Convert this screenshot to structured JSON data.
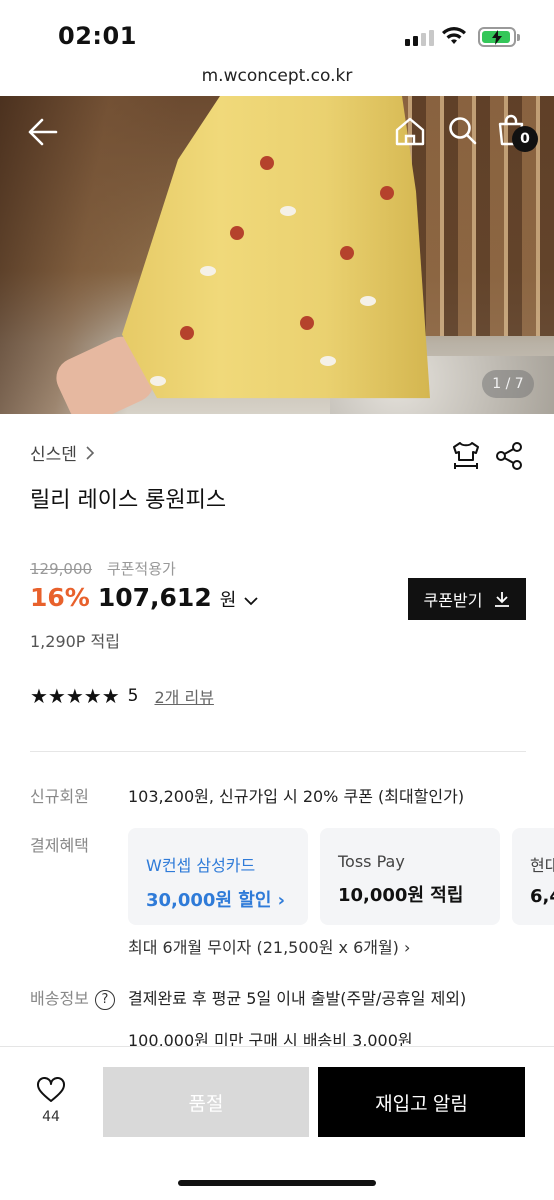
{
  "status_bar": {
    "time": "02:01"
  },
  "browser": {
    "url": "m.wconcept.co.kr"
  },
  "hero": {
    "counter": "1 / 7",
    "cart_count": "0"
  },
  "product": {
    "brand": "신스덴",
    "name": "릴리 레이스 롱원피스",
    "original_price": "129,000",
    "coupon_price_label": "쿠폰적용가",
    "discount": "16%",
    "price": "107,612",
    "currency": "원",
    "points": "1,290P 적립",
    "rating_stars": 5,
    "rating_score": "5",
    "reviews": "2개 리뷰"
  },
  "coupon_button": {
    "label": "쿠폰받기"
  },
  "info": {
    "new_member_label": "신규회원",
    "new_member_value": "103,200원, 신규가입 시 20% 쿠폰 (최대할인가)",
    "payment_label": "결제혜택",
    "payment_cards": [
      {
        "title": "W컨셉 삼성카드",
        "benefit": "30,000원 할인 ›"
      },
      {
        "title": "Toss Pay",
        "benefit": "10,000원 적립"
      },
      {
        "title": "현대",
        "benefit": "6,4"
      }
    ],
    "installment": "최대 6개월 무이자 (21,500원 x 6개월)  ›",
    "shipping_label": "배송정보",
    "shipping_line1": "결제완료 후 평균 5일 이내 출발(주말/공휴일 제외)",
    "shipping_line2": "100,000원 미만 구매 시 배송비 3,000원"
  },
  "bottom_bar": {
    "wish_count": "44",
    "soldout_label": "품절",
    "restock_label": "재입고 알림"
  },
  "colors": {
    "discount": "#e8612c",
    "samsung_blue": "#2f7bd8",
    "button_dark": "#111111",
    "soldout_gray": "#d9d9d9"
  }
}
